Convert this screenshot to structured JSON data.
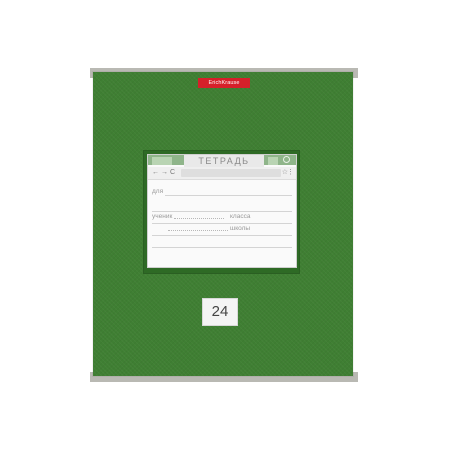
{
  "brand": {
    "name": "ErichKrause",
    "tab_color": "#d6202a"
  },
  "cover": {
    "color": "#3f7f33"
  },
  "label": {
    "title": "ТЕТРАДЬ",
    "nav_back": "←",
    "nav_forward": "→",
    "nav_reload": "C",
    "star_icon": "star-icon",
    "menu_icon": "menu-icon",
    "fields": {
      "for": "для",
      "student": "ученик",
      "class": "класса",
      "school": "школы"
    }
  },
  "sheets": {
    "count": "24"
  }
}
